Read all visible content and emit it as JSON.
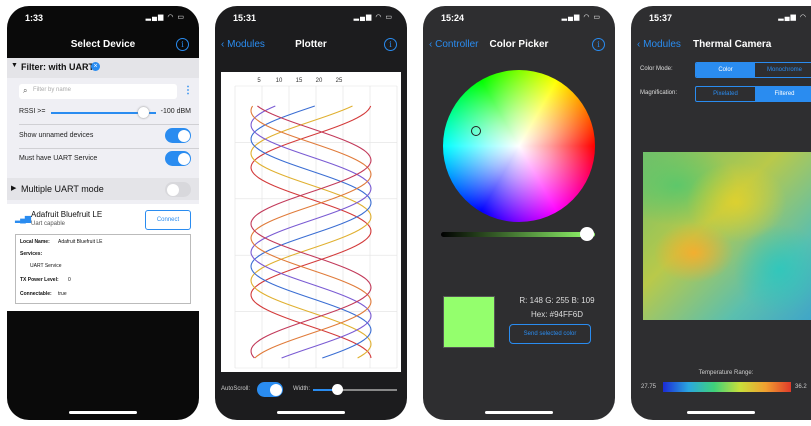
{
  "phones": [
    {
      "time": "1:33",
      "nav_title": "Select Device",
      "filter": {
        "header": "Filter: with UART",
        "search_placeholder": "Filter by name",
        "rssi_label": "RSSI >=",
        "rssi_value": "-100 dBM",
        "rssi_slider_fraction": 0.88,
        "show_unnamed": "Show unnamed devices",
        "must_uart": "Must have UART Service"
      },
      "multi_uart": "Multiple UART mode",
      "device": {
        "name": "Adafruit Bluefruit LE",
        "subtitle": "Uart capable",
        "connect": "Connect",
        "details": {
          "local_name_label": "Local Name:",
          "local_name_value": "Adafruit Bluefruit LE",
          "services_label": "Services:",
          "services_value": "UART Service",
          "tx_label": "TX Power Level:",
          "tx_value": "0",
          "connectable_label": "Connectable:",
          "connectable_value": "true"
        }
      }
    },
    {
      "time": "15:31",
      "back": "Modules",
      "nav_title": "Plotter",
      "x_ticks": [
        "5",
        "10",
        "15",
        "20",
        "25"
      ],
      "autoscroll_label": "AutoScroll:",
      "width_label": "Width:",
      "width_slider_fraction": 0.28
    },
    {
      "time": "15:24",
      "back": "Controller",
      "nav_title": "Color Picker",
      "rgb": "R: 148  G: 255  B: 109",
      "hex": "Hex: #94FF6D",
      "swatch_color": "#94ff6d",
      "send_button": "Send selected color",
      "brightness_fraction": 0.95
    },
    {
      "time": "15:37",
      "back": "Modules",
      "nav_title": "Thermal Camera",
      "color_mode_label": "Color Mode:",
      "color_mode_options": [
        "Color",
        "Monochrome"
      ],
      "magnification_label": "Magnification:",
      "magnification_options": [
        "Pixelated",
        "Filtered"
      ],
      "temp_range_label": "Temperature Range:",
      "temp_min": "27.75",
      "temp_max": "36.2"
    }
  ],
  "accent_color": "#2a8cf0"
}
